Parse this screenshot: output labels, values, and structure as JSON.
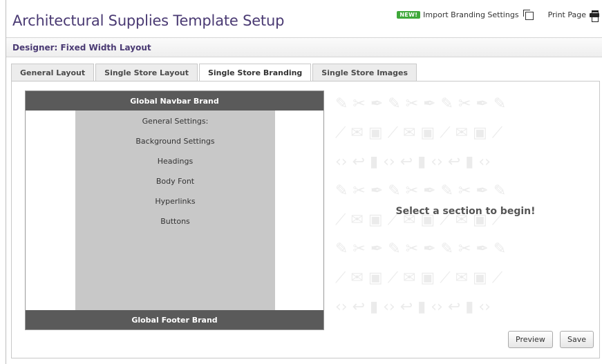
{
  "page": {
    "title": "Architectural Supplies Template Setup"
  },
  "header": {
    "new_badge": "NEW!",
    "import_label": "Import Branding Settings",
    "print_label": "Print Page"
  },
  "designer": {
    "label": "Designer: Fixed Width Layout"
  },
  "tabs": [
    {
      "label": "General Layout",
      "active": false
    },
    {
      "label": "Single Store Layout",
      "active": false
    },
    {
      "label": "Single Store Branding",
      "active": true
    },
    {
      "label": "Single Store Images",
      "active": false
    }
  ],
  "preview": {
    "navbar_label": "Global Navbar Brand",
    "footer_label": "Global Footer Brand",
    "settings": [
      "General Settings:",
      "Background Settings",
      "Headings",
      "Body Font",
      "Hyperlinks",
      "Buttons"
    ]
  },
  "canvas": {
    "message": "Select a section to begin!"
  },
  "buttons": {
    "preview_label": "Preview",
    "save_label": "Save"
  },
  "colors": {
    "title_purple": "#4a3a73",
    "brand_bar": "#5a5a5a",
    "settings_bg": "#c8c8c8",
    "new_badge": "#3fa83a"
  }
}
